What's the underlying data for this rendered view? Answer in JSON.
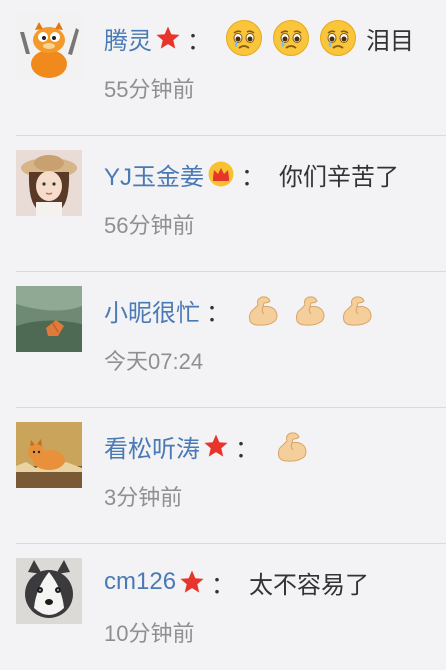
{
  "comments": [
    {
      "username": "腾灵",
      "badge": "star-icon",
      "emojis": [
        "crying-emoji-icon",
        "crying-emoji-icon",
        "crying-emoji-icon"
      ],
      "text": "泪目",
      "time": "55分钟前",
      "avatar": "garfield-avatar"
    },
    {
      "username": "YJ玉金姜",
      "badge": "crown-icon",
      "emojis": [],
      "text": "你们辛苦了",
      "time": "56分钟前",
      "avatar": "girl-avatar"
    },
    {
      "username": "小昵很忙",
      "badge": "",
      "emojis": [
        "flexed-biceps-icon",
        "flexed-biceps-icon",
        "flexed-biceps-icon"
      ],
      "text": "",
      "time": "今天07:24",
      "avatar": "leaf-avatar"
    },
    {
      "username": "看松听涛",
      "badge": "star-icon",
      "emojis": [
        "flexed-biceps-icon"
      ],
      "text": "",
      "time": "3分钟前",
      "avatar": "cat-avatar"
    },
    {
      "username": "cm126",
      "badge": "star-icon",
      "emojis": [],
      "text": "太不容易了",
      "time": "10分钟前",
      "avatar": "husky-avatar"
    }
  ],
  "separator": "：",
  "colors": {
    "username": "#4a7ab5",
    "text": "#333333",
    "time": "#8f8f8f",
    "background": "#f3f3f5",
    "divider": "#d9d9dc",
    "star": "#e8352c",
    "crown": "#f5b31c"
  }
}
